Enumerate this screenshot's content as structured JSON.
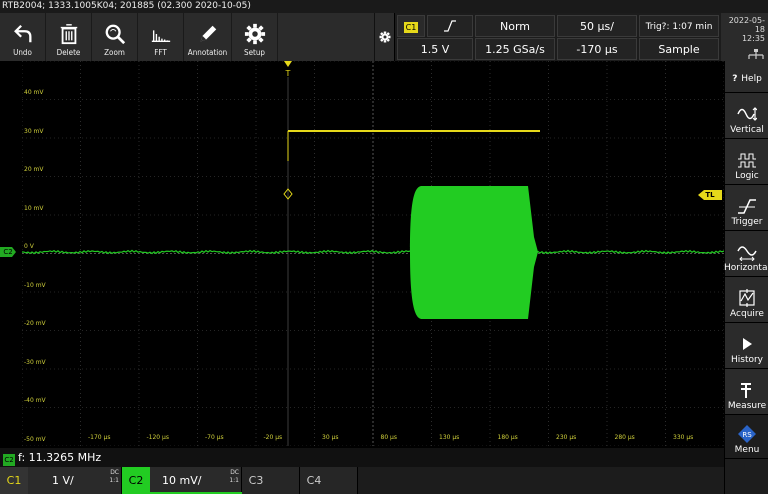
{
  "title": "RTB2004; 1333.1005K04; 201885 (02.300 2020-10-05)",
  "toolbar": {
    "undo": "Undo",
    "delete": "Delete",
    "zoom": "Zoom",
    "fft": "FFT",
    "annotation": "Annotation",
    "setup": "Setup"
  },
  "trigger": {
    "source": "C1",
    "slope_symbol": "⌠",
    "mode": "Norm",
    "timebase": "50 µs/",
    "trig_time": "Trig?: 1:07 min",
    "level": "1.5 V",
    "sample_rate": "1.25 GSa/s",
    "position": "-170 µs",
    "acq_mode": "Sample"
  },
  "datetime": {
    "date": "2022-05-18",
    "time": "12:35"
  },
  "plot": {
    "y_labels": [
      "40 mV",
      "30 mV",
      "20 mV",
      "10 mV",
      "0 V",
      "-10 mV",
      "-20 mV",
      "-30 mV",
      "-40 mV",
      "-50 mV"
    ],
    "x_labels": [
      "-170 µs",
      "-120 µs",
      "-70 µs",
      "-20 µs",
      "30 µs",
      "80 µs",
      "130 µs",
      "180 µs",
      "230 µs",
      "280 µs",
      "330 µs"
    ],
    "trigger_marker": "T",
    "c2_marker": "C2",
    "tl_marker": "TL",
    "colors": {
      "c1": "#e6d91a",
      "c2": "#22cc22",
      "grid": "#4a4a4a"
    }
  },
  "sidebar": {
    "help": "Help",
    "items": [
      "Vertical",
      "Logic",
      "Trigger",
      "Horizontal",
      "Acquire",
      "History",
      "Measure",
      "Menu"
    ]
  },
  "measurement": {
    "tag": "C2",
    "text": "f: 11.3265 MHz"
  },
  "channels": {
    "c1": {
      "label": "C1",
      "scale": "1 V/",
      "coupling": "DC",
      "bw": "1:1"
    },
    "c2": {
      "label": "C2",
      "scale": "10 mV/",
      "coupling": "DC",
      "bw": "1:1"
    },
    "c3": {
      "label": "C3"
    },
    "c4": {
      "label": "C4"
    }
  }
}
